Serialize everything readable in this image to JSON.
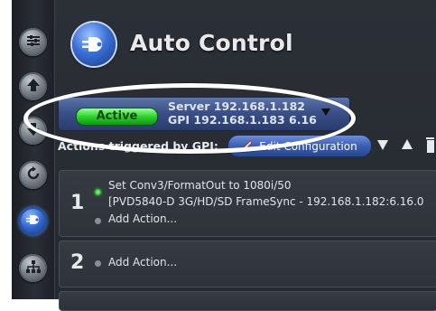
{
  "app": {
    "title": "Auto Control"
  },
  "sidebar": {
    "items": [
      {
        "name": "settings-sliders",
        "icon": "sliders-icon"
      },
      {
        "name": "upload",
        "icon": "arrow-up-icon"
      },
      {
        "name": "download",
        "icon": "arrow-down-icon"
      },
      {
        "name": "refresh",
        "icon": "refresh-icon"
      },
      {
        "name": "auto-control",
        "icon": "auto-control-plug-icon",
        "active": true
      },
      {
        "name": "network",
        "icon": "network-tree-icon"
      }
    ]
  },
  "status": {
    "state": "Active",
    "server": "Server 192.168.1.182",
    "gpi": "GPI 192.168.1.183 6.16"
  },
  "actions": {
    "label": "Actions triggered by GPI:",
    "edit_button": "Edit Configuration"
  },
  "groups": [
    {
      "number": "1",
      "lines": [
        "Set Conv3/FormatOut to 1080i/50",
        "[PVD5840-D 3G/HD/SD FrameSync - 192.168.1.182:6.16.0"
      ],
      "add_action": "Add Action..."
    },
    {
      "number": "2",
      "add_action": "Add Action..."
    }
  ],
  "colors": {
    "accent_blue": "#3b5db3",
    "active_green": "#2ed12e",
    "panel_dark": "#2b2f36"
  }
}
